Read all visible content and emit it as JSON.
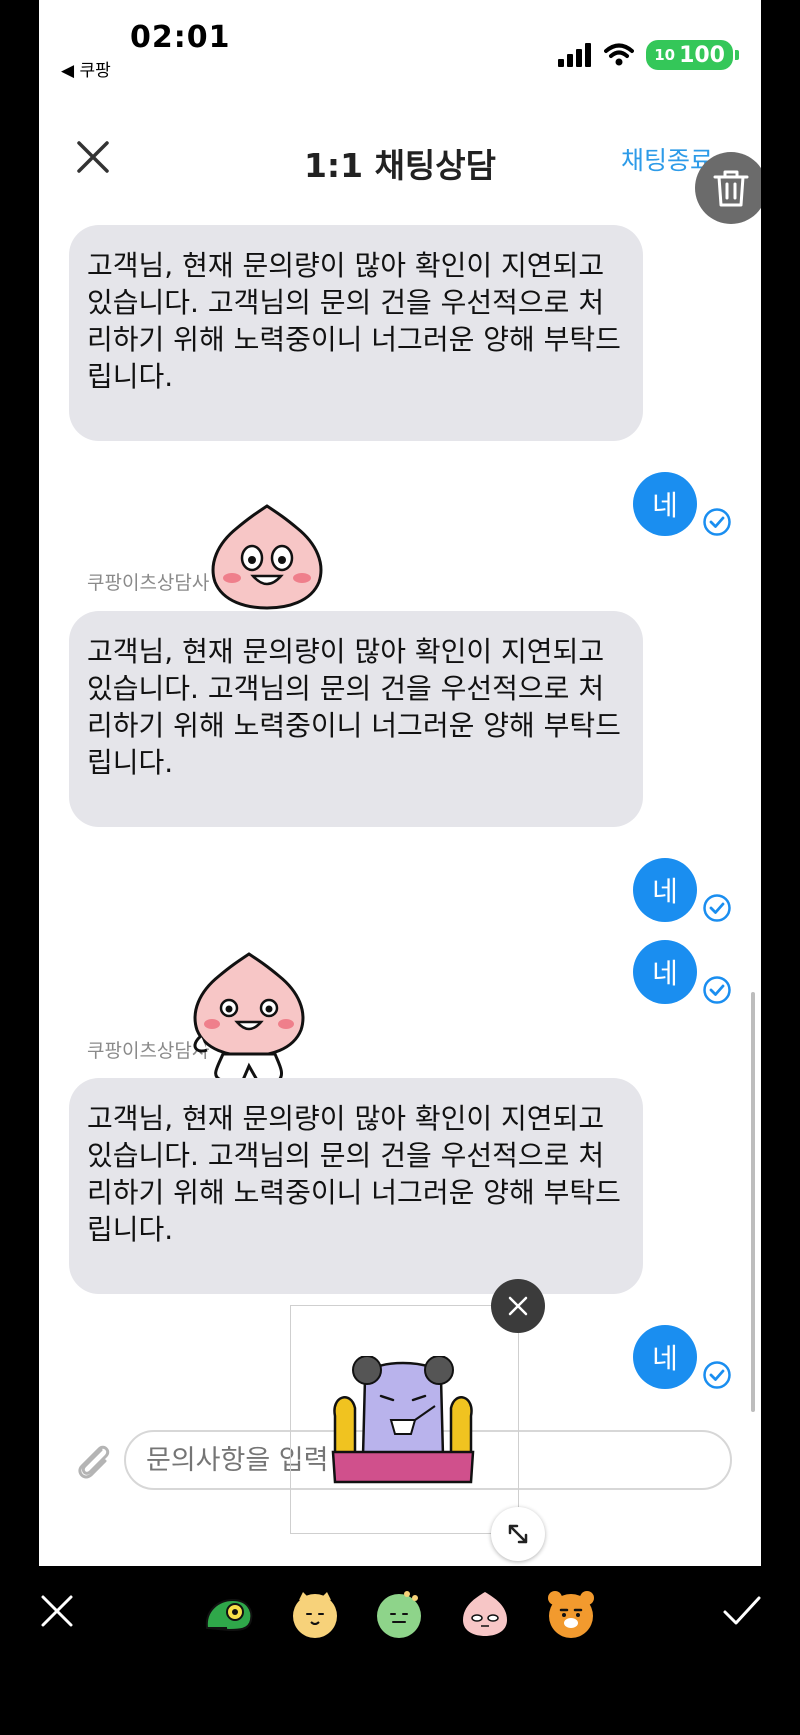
{
  "status": {
    "time": "02:01",
    "back_app": "◀ 쿠팡",
    "battery_small": "10",
    "battery": "100"
  },
  "header": {
    "title": "1:1 채팅상담",
    "end_chat": "채팅종료"
  },
  "messages": {
    "agent_name": "쿠팡이츠상담사",
    "agent_text": "고객님, 현재 문의량이 많아 확인이 지연되고 있습니다. 고객님의 문의 건을 우선적으로 처리하기 위해 노력중이니 너그러운 양해 부탁드립니다.",
    "reply": "네"
  },
  "input": {
    "placeholder": "문의사항을 입력"
  },
  "colors": {
    "my_bubble": "#1a8ef0",
    "agent_bubble": "#e5e5ea",
    "link": "#2d9be8"
  },
  "icons": [
    "close-icon",
    "trash-icon",
    "read-check-icon",
    "paperclip-icon",
    "resize-icon",
    "check-icon"
  ]
}
